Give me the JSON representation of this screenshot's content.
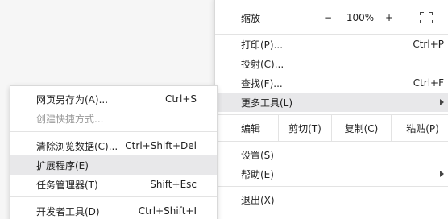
{
  "main_menu": {
    "zoom": {
      "label": "缩放",
      "minus": "−",
      "value": "100%",
      "plus": "+",
      "fullscreen_icon": "fullscreen-icon"
    },
    "print": {
      "label": "打印(P)...",
      "shortcut": "Ctrl+P"
    },
    "cast": {
      "label": "投射(C)..."
    },
    "find": {
      "label": "查找(F)...",
      "shortcut": "Ctrl+F"
    },
    "more_tools": {
      "label": "更多工具(L)"
    },
    "edit": {
      "label": "编辑",
      "cut": "剪切(T)",
      "copy": "复制(C)",
      "paste": "粘贴(P)"
    },
    "settings": {
      "label": "设置(S)"
    },
    "help": {
      "label": "帮助(E)"
    },
    "exit": {
      "label": "退出(X)"
    }
  },
  "sub_menu": {
    "save_page": {
      "label": "网页另存为(A)...",
      "shortcut": "Ctrl+S"
    },
    "create_shortcut": {
      "label": "创建快捷方式..."
    },
    "clear_data": {
      "label": "清除浏览数据(C)...",
      "shortcut": "Ctrl+Shift+Del"
    },
    "extensions": {
      "label": "扩展程序(E)"
    },
    "task_manager": {
      "label": "任务管理器(T)",
      "shortcut": "Shift+Esc"
    },
    "dev_tools": {
      "label": "开发者工具(D)",
      "shortcut": "Ctrl+Shift+I"
    }
  }
}
